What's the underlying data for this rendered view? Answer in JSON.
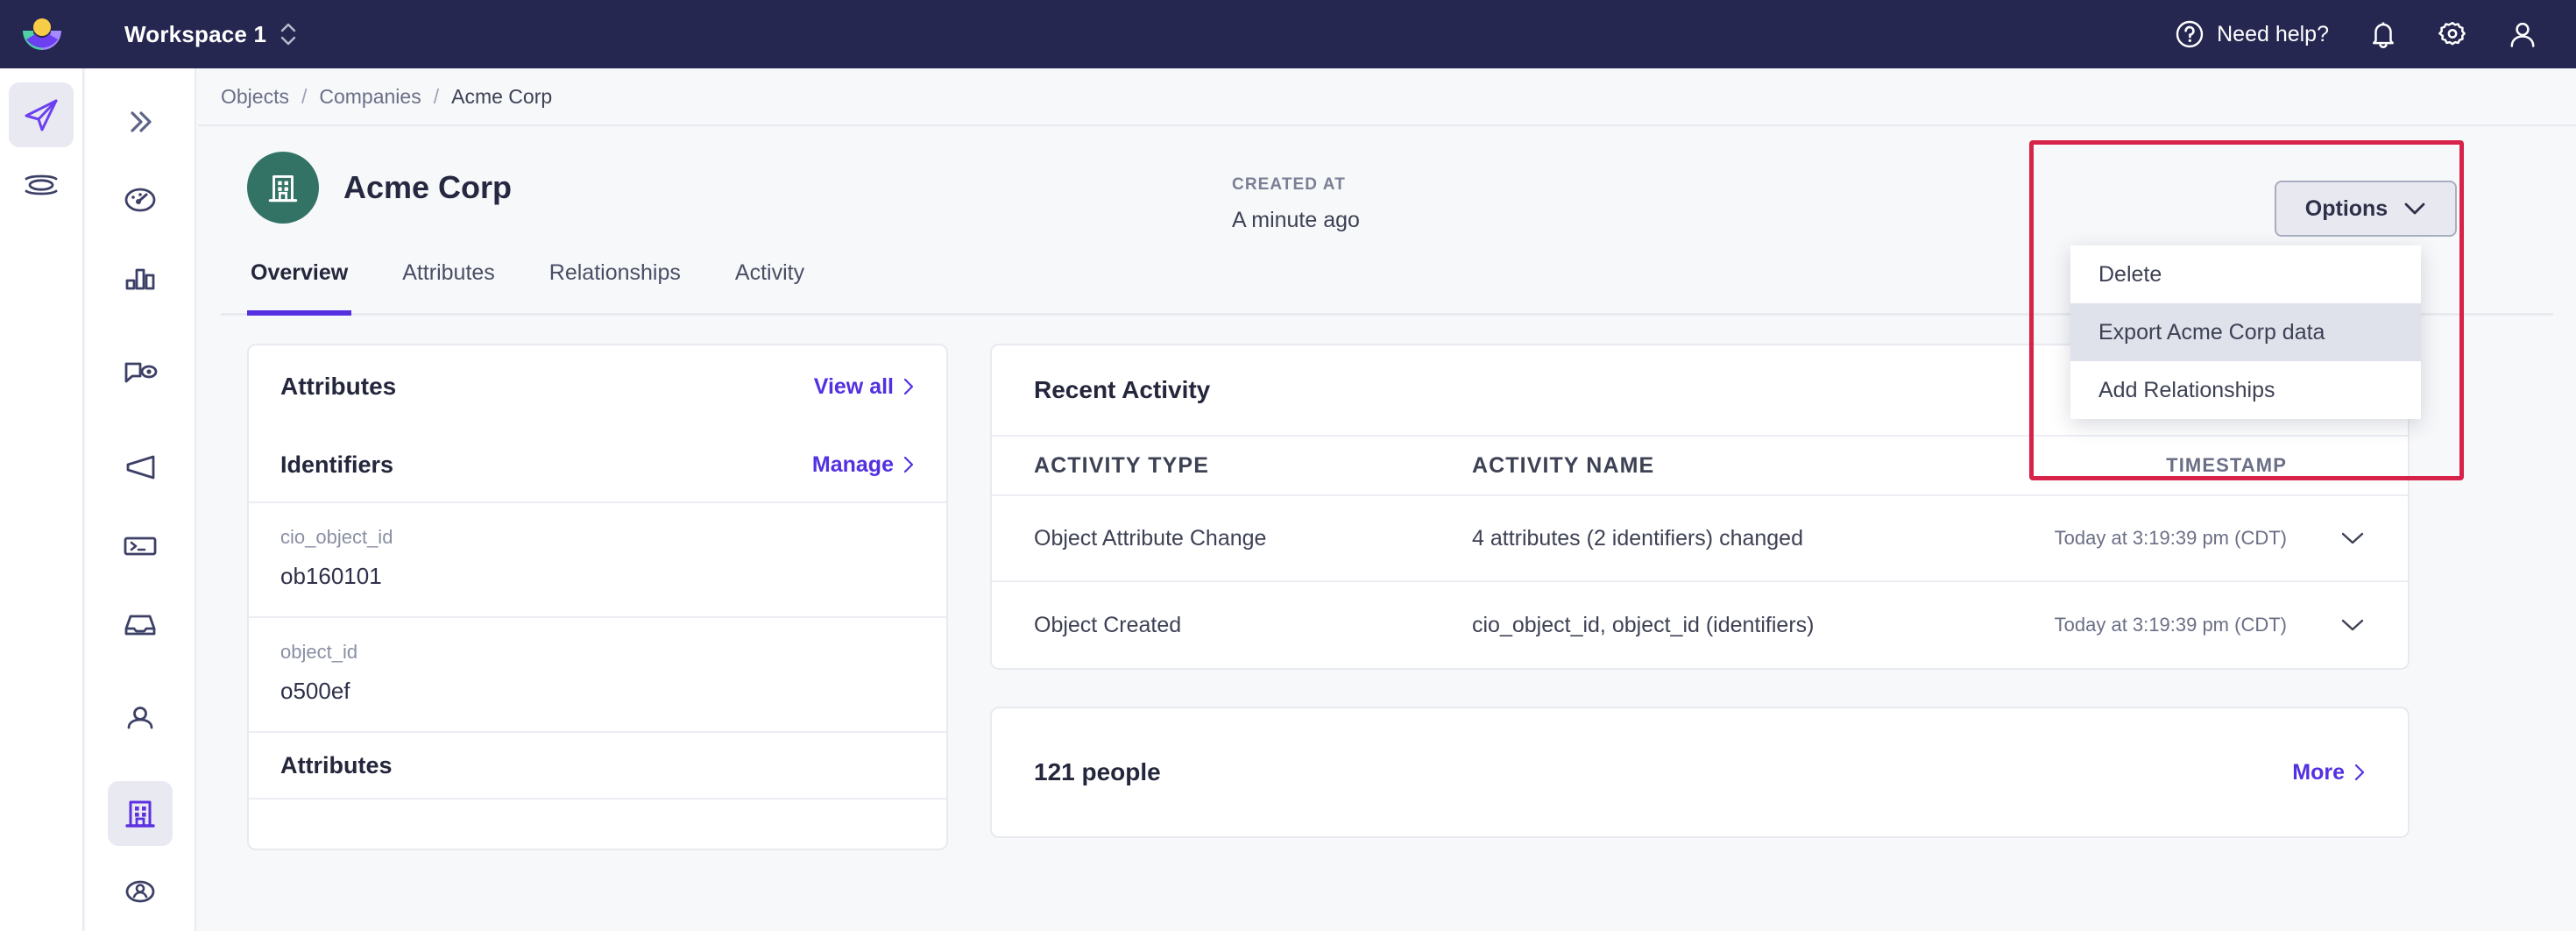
{
  "topbar": {
    "logo_icon": "customerio-logo",
    "workspace_label": "Workspace 1",
    "workspace_switcher_icon": "chevron-updown-icon",
    "help_label": "Need help?",
    "help_icon": "question-circle-icon",
    "notifications_icon": "bell-icon",
    "settings_icon": "gear-icon",
    "account_icon": "user-icon",
    "background_color": "#262750"
  },
  "rail_primary": {
    "items": [
      {
        "name": "journeys",
        "icon": "paper-plane-icon",
        "active": true
      },
      {
        "name": "data-pipelines",
        "icon": "layers-icon",
        "active": false
      }
    ]
  },
  "rail_secondary": {
    "collapse_icon": "chevron-double-right-icon",
    "items": [
      {
        "name": "dashboard",
        "icon": "speedometer-icon",
        "active": false
      },
      {
        "name": "analytics",
        "icon": "bar-chart-icon",
        "active": false
      },
      {
        "name": "campaigns",
        "icon": "message-eye-icon",
        "active": false
      },
      {
        "name": "broadcasts",
        "icon": "megaphone-icon",
        "active": false
      },
      {
        "name": "transactional",
        "icon": "terminal-icon",
        "active": false
      },
      {
        "name": "inbox",
        "icon": "inbox-icon",
        "active": false
      },
      {
        "name": "people",
        "icon": "person-icon",
        "active": false
      },
      {
        "name": "objects",
        "icon": "building-icon",
        "active": true
      },
      {
        "name": "segments",
        "icon": "person-circle-icon",
        "active": false
      }
    ]
  },
  "breadcrumb": {
    "items": [
      "Objects",
      "Companies",
      "Acme Corp"
    ],
    "separator": "/"
  },
  "hero": {
    "avatar_icon": "building-icon",
    "avatar_color": "#337366",
    "title": "Acme Corp",
    "created_label": "CREATED AT",
    "created_value": "A minute ago"
  },
  "options": {
    "button_label": "Options",
    "button_icon": "chevron-down-icon",
    "menu": [
      {
        "label": "Delete",
        "hovered": false
      },
      {
        "label": "Export Acme Corp data",
        "hovered": true
      },
      {
        "label": "Add Relationships",
        "hovered": false
      }
    ],
    "annotation_color": "#d72249"
  },
  "tabs": [
    {
      "label": "Overview",
      "active": true
    },
    {
      "label": "Attributes",
      "active": false
    },
    {
      "label": "Relationships",
      "active": false
    },
    {
      "label": "Activity",
      "active": false
    }
  ],
  "attributes_card": {
    "title": "Attributes",
    "view_all_label": "View all",
    "view_all_icon": "chevron-right-icon",
    "identifiers_title": "Identifiers",
    "manage_label": "Manage",
    "manage_icon": "chevron-right-icon",
    "identifiers": [
      {
        "key": "cio_object_id",
        "value": "ob160101"
      },
      {
        "key": "object_id",
        "value": "o500ef"
      }
    ],
    "attributes_section_title": "Attributes"
  },
  "activity_card": {
    "title": "Recent Activity",
    "columns": [
      "ACTIVITY TYPE",
      "ACTIVITY NAME",
      "TIMESTAMP"
    ],
    "rows": [
      {
        "type": "Object Attribute Change",
        "name": "4 attributes (2 identifiers) changed",
        "timestamp": "Today at 3:19:39 pm (CDT)",
        "expand_icon": "chevron-down-icon"
      },
      {
        "type": "Object Created",
        "name": "cio_object_id, object_id (identifiers)",
        "timestamp": "Today at 3:19:39 pm (CDT)",
        "expand_icon": "chevron-down-icon"
      }
    ]
  },
  "people_card": {
    "title": "121 people",
    "more_label": "More",
    "more_icon": "chevron-right-icon"
  },
  "colors": {
    "accent_purple": "#5330e0",
    "navbar": "#262750",
    "page_bg": "#f7f8fa",
    "teal": "#337366",
    "annotation_red": "#d72249"
  }
}
